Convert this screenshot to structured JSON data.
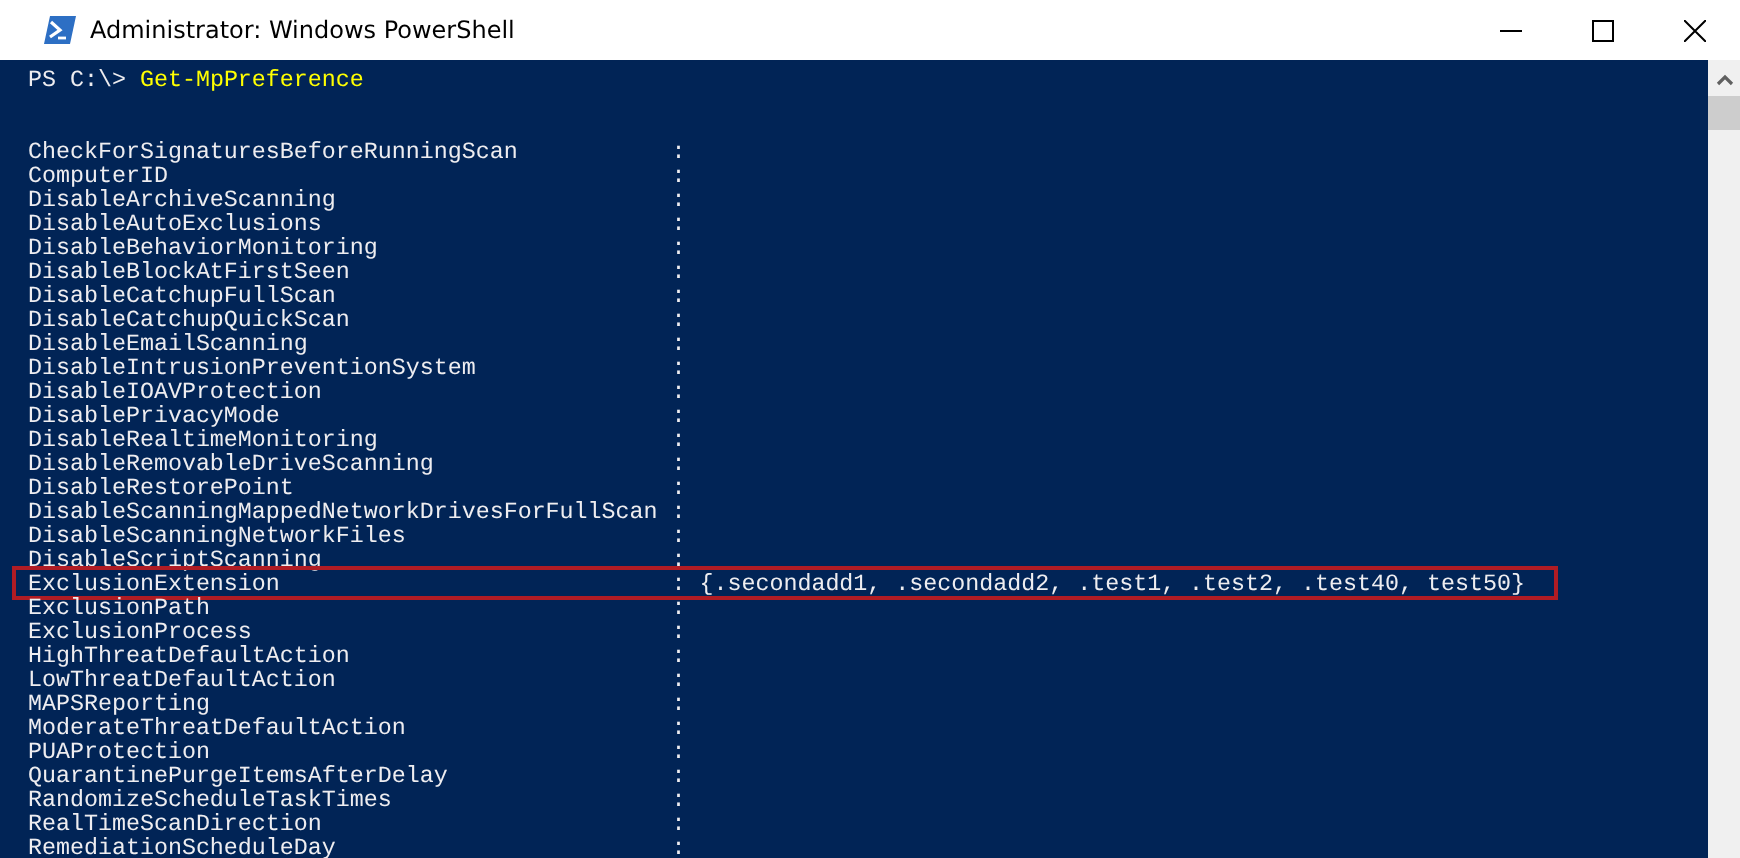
{
  "window": {
    "title": "Administrator: Windows PowerShell"
  },
  "prompt": {
    "text": "PS C:\\>",
    "command": "Get-MpPreference"
  },
  "rows": [
    {
      "name": "CheckForSignaturesBeforeRunningScan",
      "separator": ":",
      "highlighted": false
    },
    {
      "name": "ComputerID",
      "separator": ":",
      "highlighted": false
    },
    {
      "name": "DisableArchiveScanning",
      "separator": ":",
      "highlighted": false
    },
    {
      "name": "DisableAutoExclusions",
      "separator": ":",
      "highlighted": false
    },
    {
      "name": "DisableBehaviorMonitoring",
      "separator": ":",
      "highlighted": false
    },
    {
      "name": "DisableBlockAtFirstSeen",
      "separator": ":",
      "highlighted": false
    },
    {
      "name": "DisableCatchupFullScan",
      "separator": ":",
      "highlighted": false
    },
    {
      "name": "DisableCatchupQuickScan",
      "separator": ":",
      "highlighted": false
    },
    {
      "name": "DisableEmailScanning",
      "separator": ":",
      "highlighted": false
    },
    {
      "name": "DisableIntrusionPreventionSystem",
      "separator": ":",
      "highlighted": false
    },
    {
      "name": "DisableIOAVProtection",
      "separator": ":",
      "highlighted": false
    },
    {
      "name": "DisablePrivacyMode",
      "separator": ":",
      "highlighted": false
    },
    {
      "name": "DisableRealtimeMonitoring",
      "separator": ":",
      "highlighted": false
    },
    {
      "name": "DisableRemovableDriveScanning",
      "separator": ":",
      "highlighted": false
    },
    {
      "name": "DisableRestorePoint",
      "separator": ":",
      "highlighted": false
    },
    {
      "name": "DisableScanningMappedNetworkDrivesForFullScan",
      "separator": ":",
      "highlighted": false
    },
    {
      "name": "DisableScanningNetworkFiles",
      "separator": ":",
      "highlighted": false
    },
    {
      "name": "DisableScriptScanning",
      "separator": ":",
      "highlighted": false
    },
    {
      "name": "ExclusionExtension",
      "separator": ":",
      "value": "{.secondadd1, .secondadd2, .test1, .test2, .test40, test50}",
      "highlighted": true
    },
    {
      "name": "ExclusionPath",
      "separator": ":",
      "highlighted": false
    },
    {
      "name": "ExclusionProcess",
      "separator": ":",
      "highlighted": false
    },
    {
      "name": "HighThreatDefaultAction",
      "separator": ":",
      "highlighted": false
    },
    {
      "name": "LowThreatDefaultAction",
      "separator": ":",
      "highlighted": false
    },
    {
      "name": "MAPSReporting",
      "separator": ":",
      "highlighted": false
    },
    {
      "name": "ModerateThreatDefaultAction",
      "separator": ":",
      "highlighted": false
    },
    {
      "name": "PUAProtection",
      "separator": ":",
      "highlighted": false
    },
    {
      "name": "QuarantinePurgeItemsAfterDelay",
      "separator": ":",
      "highlighted": false
    },
    {
      "name": "RandomizeScheduleTaskTimes",
      "separator": ":",
      "highlighted": false
    },
    {
      "name": "RealTimeScanDirection",
      "separator": ":",
      "highlighted": false
    },
    {
      "name": "RemediationScheduleDay",
      "separator": ":",
      "highlighted": false
    }
  ]
}
